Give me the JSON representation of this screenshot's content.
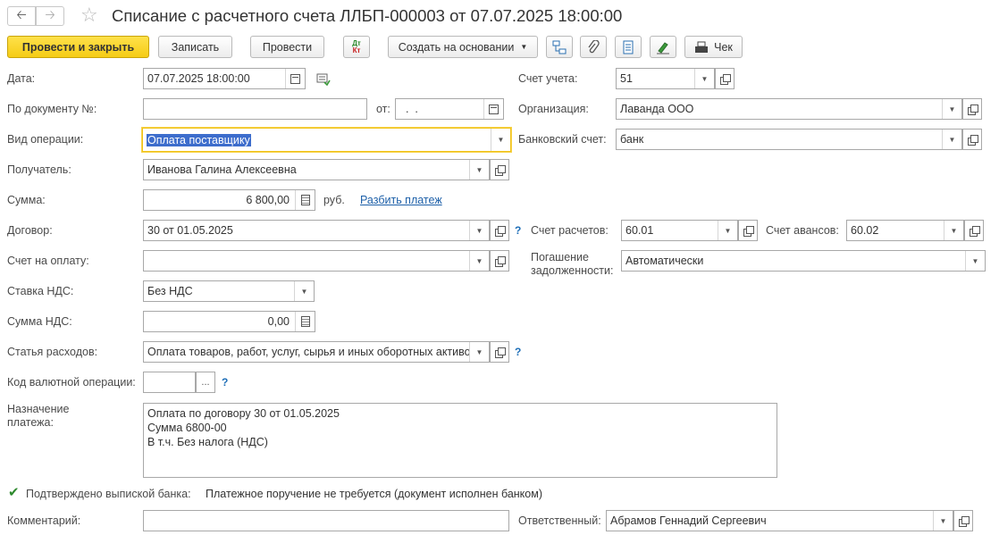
{
  "window": {
    "title": "Списание с расчетного счета ЛЛБП-000003 от 07.07.2025 18:00:00"
  },
  "toolbar": {
    "post_close": "Провести и закрыть",
    "save": "Записать",
    "post": "Провести",
    "dtkt_top": "Дт",
    "dtkt_bottom": "Кт",
    "create_based": "Создать на основании",
    "check": "Чек"
  },
  "form": {
    "date_label": "Дата:",
    "date_value": "07.07.2025 18:00:00",
    "docnum_label": "По документу №:",
    "docnum_value": "",
    "from_label": "от:",
    "from_value": "  .  .",
    "op_label": "Вид операции:",
    "op_value": "Оплата поставщику",
    "recipient_label": "Получатель:",
    "recipient_value": "Иванова Галина Алексеевна",
    "sum_label": "Сумма:",
    "sum_value": "6 800,00",
    "currency": "руб.",
    "split_link": "Разбить платеж",
    "contract_label": "Договор:",
    "contract_value": "30 от 01.05.2025",
    "invoice_label": "Счет на оплату:",
    "invoice_value": "",
    "vat_rate_label": "Ставка НДС:",
    "vat_rate_value": "Без НДС",
    "vat_sum_label": "Сумма НДС:",
    "vat_sum_value": "0,00",
    "expense_label": "Статья расходов:",
    "expense_value": "Оплата товаров, работ, услуг, сырья и иных оборотных активов",
    "fx_label": "Код валютной операции:",
    "fx_value": "",
    "fx_btn": "...",
    "help": "?",
    "purpose_label": "Назначение платежа:",
    "purpose_lines": [
      "Оплата по договору 30 от 01.05.2025",
      "Сумма 6800-00",
      "В т.ч. Без налога (НДС)"
    ],
    "account_label": "Счет учета:",
    "account_value": "51",
    "org_label": "Организация:",
    "org_value": "Лаванда ООО",
    "bank_label": "Банковский счет:",
    "bank_value": "банк",
    "settle_label": "Счет расчетов:",
    "settle_value": "60.01",
    "advance_label": "Счет авансов:",
    "advance_value": "60.02",
    "repay_label": "Погашение задолженности:",
    "repay_value": "Автоматически",
    "confirmed_label": "Подтверждено выпиской банка:",
    "confirmed_checked": true,
    "confirmed_note": "Платежное поручение не требуется (документ исполнен банком)",
    "comment_label": "Комментарий:",
    "comment_value": "",
    "responsible_label": "Ответственный:",
    "responsible_value": "Абрамов Геннадий Сергеевич"
  }
}
